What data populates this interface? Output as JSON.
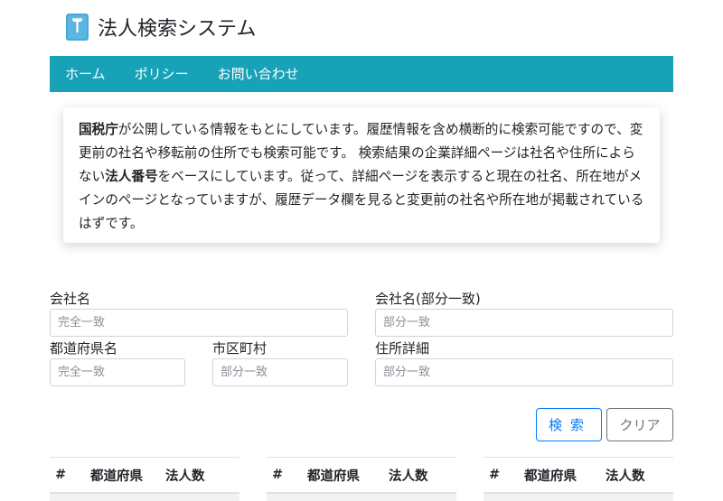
{
  "header": {
    "title": "法人検索システム",
    "logo_icon": "book-icon"
  },
  "nav": {
    "items": [
      "ホーム",
      "ポリシー",
      "お問い合わせ"
    ],
    "color": "#17a2b8"
  },
  "info": {
    "p1_bold": "国税庁",
    "p1_text": "が公開している情報をもとにしています。履歴情報を含め横断的に検索可能ですので、変更前の社名や移転前の住所でも検索可能です。 検索結果の企業詳細ページは社名や住所によらない",
    "p2_bold": "法人番号",
    "p2_text": "をベースにしています。従って、詳細ページを表示すると現在の社名、所在地がメインのページとなっていますが、履歴データ欄を見ると変更前の社名や所在地が掲載されているはずです。"
  },
  "form": {
    "company_name": {
      "label": "会社名",
      "placeholder": "完全一致"
    },
    "company_name_partial": {
      "label": "会社名(部分一致)",
      "placeholder": "部分一致"
    },
    "prefecture": {
      "label": "都道府県名",
      "placeholder": "完全一致"
    },
    "city": {
      "label": "市区町村",
      "placeholder": "部分一致"
    },
    "address": {
      "label": "住所詳細",
      "placeholder": "部分一致"
    },
    "search_button": "検索",
    "clear_button": "クリア"
  },
  "tables": {
    "headers": [
      "#",
      "都道府県",
      "法人数"
    ]
  }
}
